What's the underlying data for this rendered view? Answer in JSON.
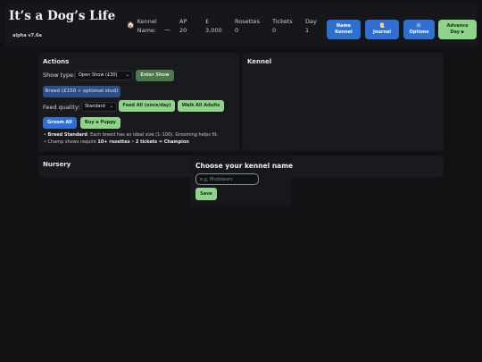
{
  "header": {
    "title": "It’s a Dog’s Life",
    "version": "alpha v7.6a",
    "stats": {
      "kennel_label": "Kennel",
      "kennel_label2": "Name:",
      "kennel_value": "—",
      "ap_label": "AP",
      "ap_value": "20",
      "money_label": "£",
      "money_value": "3,000",
      "rosettes_label": "Rosettes",
      "rosettes_value": "0",
      "tickets_label": "Tickets",
      "tickets_value": "0",
      "day_label": "Day",
      "day_value": "1"
    },
    "buttons": {
      "name_kennel_l1": "Name",
      "name_kennel_l2": "Kennel",
      "journal_icon": "📜",
      "journal": "Journal",
      "options_icon": "⚙️",
      "options": "Options",
      "advance_l1": "Advance",
      "advance_l2": "Day ▶"
    }
  },
  "actions": {
    "title": "Actions",
    "show_type_label": "Show type:",
    "show_type_selected": "Open Show (£30)",
    "enter_show": "Enter Show",
    "breed": "Breed (£150 + optional stud)",
    "feed_quality_label": "Feed quality:",
    "feed_quality_selected": "Standard",
    "feed_all": "Feed All (once/day)",
    "walk_all": "Walk All Adults",
    "groom_all": "Groom All",
    "buy_puppy": "Buy a Puppy",
    "note1_bold": "Breed Standard",
    "note1_rest": ": Each breed has an ideal size (1–100). Grooming helps fit.",
    "note2_pre": "• Champ shows require ",
    "note2_b1": "10+ rosettes",
    "note2_mid": " • ",
    "note2_b2": "2 tickets = Champion",
    "bullet": "• "
  },
  "kennel": {
    "title": "Kennel"
  },
  "nursery": {
    "title": "Nursery"
  },
  "modal": {
    "title": "Choose your kennel name",
    "placeholder": "e.g. Muddwars",
    "save": "Save"
  },
  "colors": {
    "accent_blue": "#2f6fd1",
    "accent_green": "#8fd48a",
    "background": "#111214",
    "panel": "#181a1e"
  },
  "icons": {
    "kennel": "house-icon",
    "journal": "scroll-icon",
    "options": "gear-icon",
    "select": "chevron-down-icon"
  }
}
